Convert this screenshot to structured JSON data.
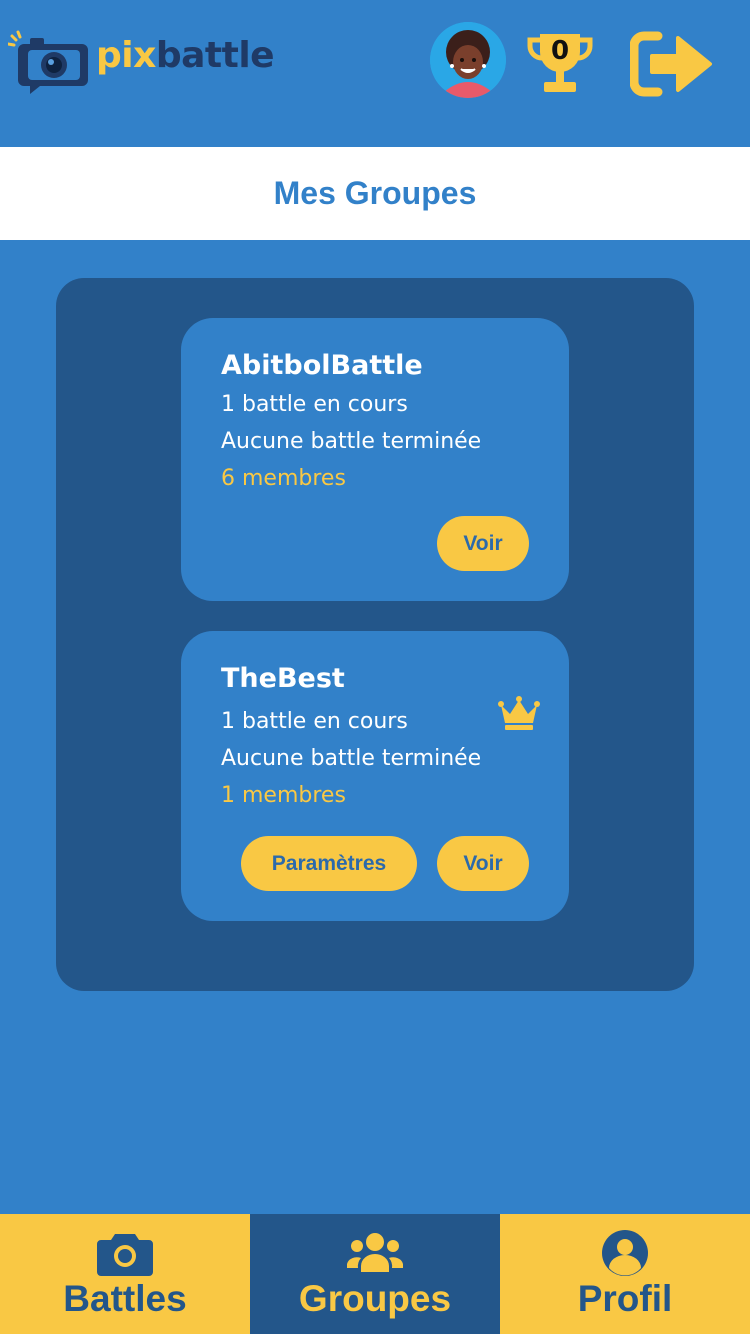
{
  "header": {
    "logo": {
      "pix": "pix",
      "battle": "battle",
      "icon": "camera-chat-icon"
    },
    "avatar_icon": "user-avatar",
    "trophy": {
      "icon": "trophy-icon",
      "count": "0"
    },
    "logout_icon": "logout-icon"
  },
  "page": {
    "title": "Mes Groupes"
  },
  "groups": [
    {
      "name": "AbitbolBattle",
      "ongoing": "1 battle en cours",
      "finished": "Aucune battle terminée",
      "members": "6 membres",
      "is_owner": false,
      "view_label": "Voir"
    },
    {
      "name": "TheBest",
      "ongoing": "1 battle en cours",
      "finished": "Aucune battle terminée",
      "members": "1 membres",
      "is_owner": true,
      "owner_icon": "crown-icon",
      "settings_label": "Paramètres",
      "view_label": "Voir"
    }
  ],
  "tabbar": {
    "active": "Groupes",
    "items": [
      {
        "label": "Battles",
        "icon": "camera-icon"
      },
      {
        "label": "Groupes",
        "icon": "users-icon"
      },
      {
        "label": "Profil",
        "icon": "user-circle-icon"
      }
    ]
  },
  "colors": {
    "primary": "#3281c9",
    "dark": "#23568a",
    "accent": "#f9c844",
    "white": "#ffffff"
  }
}
